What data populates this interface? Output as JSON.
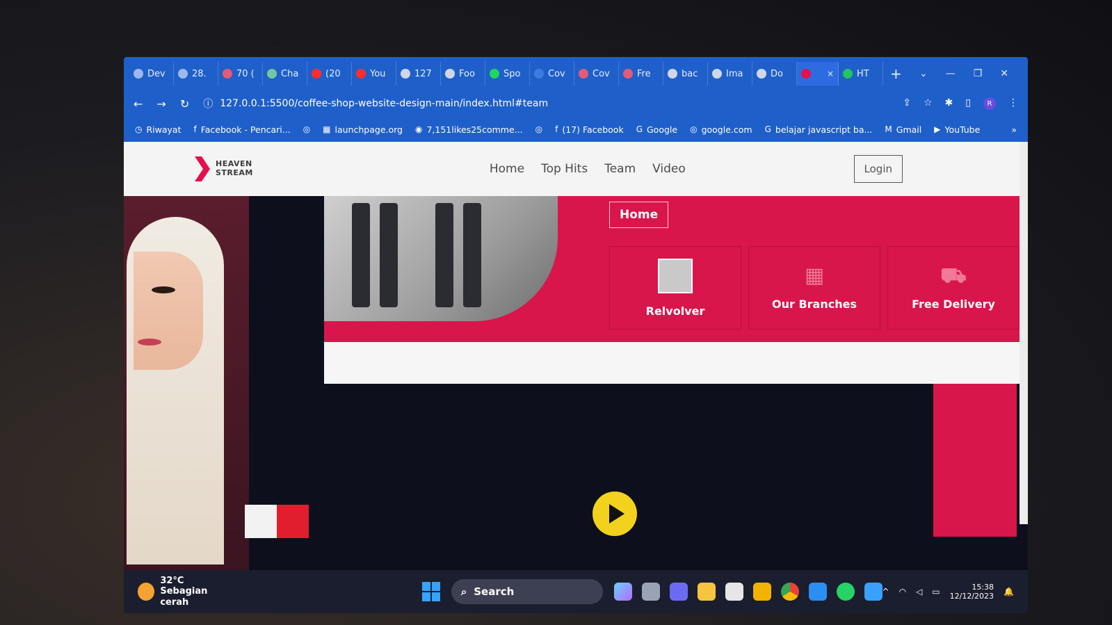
{
  "browser": {
    "tabs": [
      {
        "label": "Dev",
        "color": "#9db8ef"
      },
      {
        "label": "28.",
        "color": "#9db8ef"
      },
      {
        "label": "70 (",
        "color": "#e45a7a"
      },
      {
        "label": "Cha",
        "color": "#74c69d"
      },
      {
        "label": "(20",
        "color": "#ff2e2e"
      },
      {
        "label": "You",
        "color": "#ff2e2e"
      },
      {
        "label": "127",
        "color": "#cfd8e8"
      },
      {
        "label": "Foo",
        "color": "#cfd8e8"
      },
      {
        "label": "Spo",
        "color": "#1ed760"
      },
      {
        "label": "Cov",
        "color": "#3d7be0"
      },
      {
        "label": "Cov",
        "color": "#e45a7a"
      },
      {
        "label": "Fre",
        "color": "#e45a7a"
      },
      {
        "label": "bac",
        "color": "#cfd8e8"
      },
      {
        "label": "Ima",
        "color": "#cfd8e8"
      },
      {
        "label": "Do",
        "color": "#cfd8e8"
      },
      {
        "label": "",
        "color": "#e3114e",
        "active": true
      },
      {
        "label": "HT",
        "color": "#22c55e"
      }
    ],
    "close_tab": "×",
    "new_tab": "+",
    "window_controls": {
      "dropdown": "⌄",
      "minimize": "—",
      "restore": "❐",
      "close": "✕"
    },
    "nav": {
      "back": "←",
      "forward": "→",
      "reload": "↻",
      "info": "ⓘ"
    },
    "url": "127.0.0.1:5500/coffee-shop-website-design-main/index.html#team",
    "address_icons": {
      "share": "⇪",
      "star": "☆",
      "extensions": "✱",
      "sidebar": "▯",
      "profile": "R",
      "menu": "⋮"
    },
    "bookmarks": [
      {
        "label": "Riwayat",
        "icon": "history-icon",
        "glyph": "◷"
      },
      {
        "label": "Facebook - Pencari...",
        "icon": "facebook-icon",
        "glyph": "f"
      },
      {
        "label": "",
        "icon": "globe-icon",
        "glyph": "◎"
      },
      {
        "label": "launchpage.org",
        "icon": "grid-icon",
        "glyph": "▦"
      },
      {
        "label": "7,151likes25comme...",
        "icon": "instagram-icon",
        "glyph": "◉"
      },
      {
        "label": "",
        "icon": "globe-icon",
        "glyph": "◎"
      },
      {
        "label": "(17) Facebook",
        "icon": "facebook-icon",
        "glyph": "f"
      },
      {
        "label": "Google",
        "icon": "google-icon",
        "glyph": "G"
      },
      {
        "label": "google.com",
        "icon": "globe-icon",
        "glyph": "◎"
      },
      {
        "label": "belajar javascript ba...",
        "icon": "google-icon",
        "glyph": "G"
      },
      {
        "label": "Gmail",
        "icon": "gmail-icon",
        "glyph": "M"
      },
      {
        "label": "YouTube",
        "icon": "youtube-icon",
        "glyph": "▶"
      }
    ],
    "bookmarks_more": "»"
  },
  "site": {
    "logo_line1": "HEAVEN",
    "logo_line2": "STREAM",
    "menu": [
      "Home",
      "Top Hits",
      "Team",
      "Video"
    ],
    "login": "Login",
    "home_pill": "Home",
    "cards": [
      {
        "label": "Relvolver",
        "icon": "album-thumbnail"
      },
      {
        "label": "Our Branches",
        "icon": "store-icon",
        "glyph": "▦"
      },
      {
        "label": "Free Delivery",
        "icon": "truck-icon",
        "glyph": "⛟"
      }
    ],
    "accent": "#d8164c"
  },
  "taskbar": {
    "temperature": "32°C",
    "weather": "Sebagian cerah",
    "search": "Search",
    "search_glyph": "⌕",
    "tray_glyphs": {
      "chevron": "^",
      "wifi": "◠",
      "volume": "◁",
      "battery": "▭",
      "notifications": "🔔"
    },
    "time": "15:38",
    "date": "12/12/2023"
  }
}
